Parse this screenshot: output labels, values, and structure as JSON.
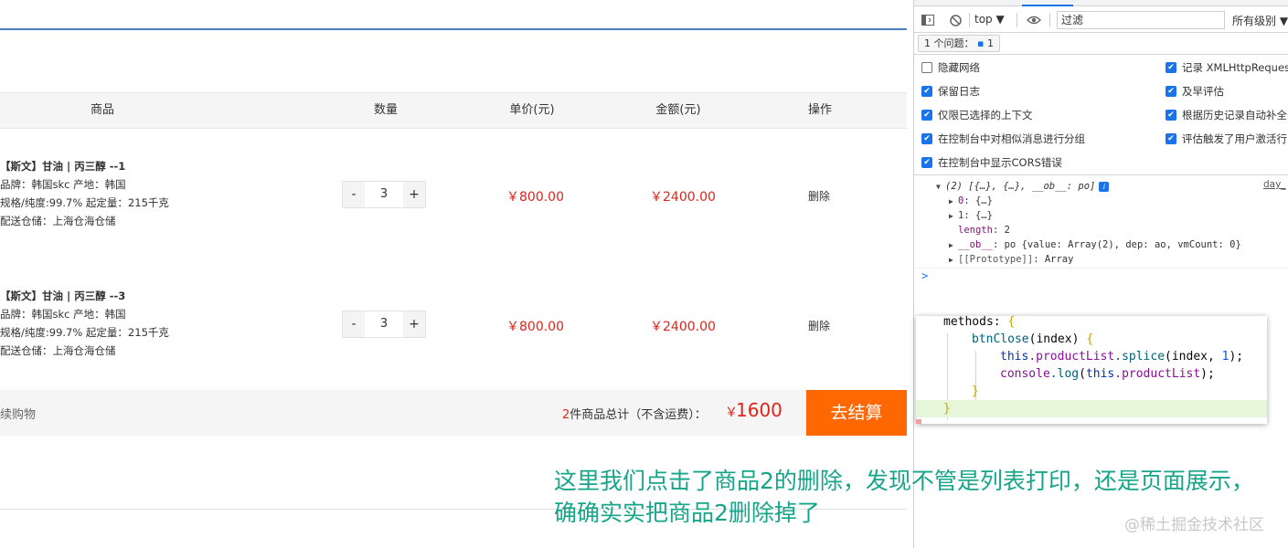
{
  "cart": {
    "headers": {
      "product": "商品",
      "quantity": "数量",
      "unit_price": "单价(元)",
      "amount": "金额(元)",
      "action": "操作"
    },
    "items": [
      {
        "name": "【斯文】甘油 | 丙三醇 --1",
        "brand_origin": "品牌：韩国skc  产地：韩国",
        "spec_moq": "规格/纯度:99.7%  起定量：215千克",
        "warehouse": "配送仓储：上海仓海仓储",
        "qty": "3",
        "price": "￥800.00",
        "amount": "￥2400.00",
        "delete_label": "删除"
      },
      {
        "name": "【斯文】甘油 | 丙三醇 --3",
        "brand_origin": "品牌：韩国skc  产地：韩国",
        "spec_moq": "规格/纯度:99.7%  起定量：215千克",
        "warehouse": "配送仓储：上海仓海仓储",
        "qty": "3",
        "price": "￥800.00",
        "amount": "￥2400.00",
        "delete_label": "删除"
      }
    ],
    "minus": "-",
    "plus": "+",
    "continue_label": "续购物",
    "summary_count": "2",
    "summary_text": "件商品总计（不含运费）：",
    "currency": "￥",
    "total": "1600",
    "checkout_label": "去结算"
  },
  "devtools": {
    "context": "top ▼",
    "filter_placeholder": "过滤",
    "levels": "所有级别 ▼",
    "issues_label": "1 个问题：",
    "issues_count": "1",
    "settings": [
      {
        "label": "隐藏网络",
        "checked": false
      },
      {
        "label": "保留日志",
        "checked": true
      },
      {
        "label": "仅限已选择的上下文",
        "checked": true
      },
      {
        "label": "在控制台中对相似消息进行分组",
        "checked": true
      },
      {
        "label": "在控制台中显示CORS错误",
        "checked": true
      },
      {
        "label": "记录 XMLHttpRequest",
        "checked": true
      },
      {
        "label": "及早评估",
        "checked": true
      },
      {
        "label": "根据历史记录自动补全",
        "checked": true
      },
      {
        "label": "评估触发了用户激活行",
        "checked": true
      }
    ],
    "console": {
      "array_summary": "(2) [{…}, {…}, __ob__: po]",
      "source_link": "day_",
      "item0_key": "0",
      "item0_val": "{…}",
      "item1_key": "1",
      "item1_val": "{…}",
      "length_key": "length",
      "length_val": "2",
      "ob_key": "__ob__",
      "ob_val": "po {value: Array(2), dep: ao, vmCount: 0}",
      "proto_key": "[[Prototype]]",
      "proto_val": "Array",
      "prompt": ">"
    }
  },
  "code": {
    "line1_a": "methods: ",
    "line1_b": "{",
    "line2_fn": "btnClose",
    "line2_rest": "(index) ",
    "line2_brace": "{",
    "line3_this": "this",
    "line3_prop": ".productList",
    "line3_call": ".splice",
    "line3_args": "(index, ",
    "line3_num": "1",
    "line3_end": ");",
    "line4_obj": "console",
    "line4_call": ".log",
    "line4_open": "(",
    "line4_this": "this",
    "line4_prop": ".productList",
    "line4_end": ");",
    "line5": "}",
    "line6": "}"
  },
  "annotation": "这里我们点击了商品2的删除，发现不管是列表打印，还是页面展示，确确实实把商品2删除掉了",
  "watermark": "@稀土掘金技术社区"
}
